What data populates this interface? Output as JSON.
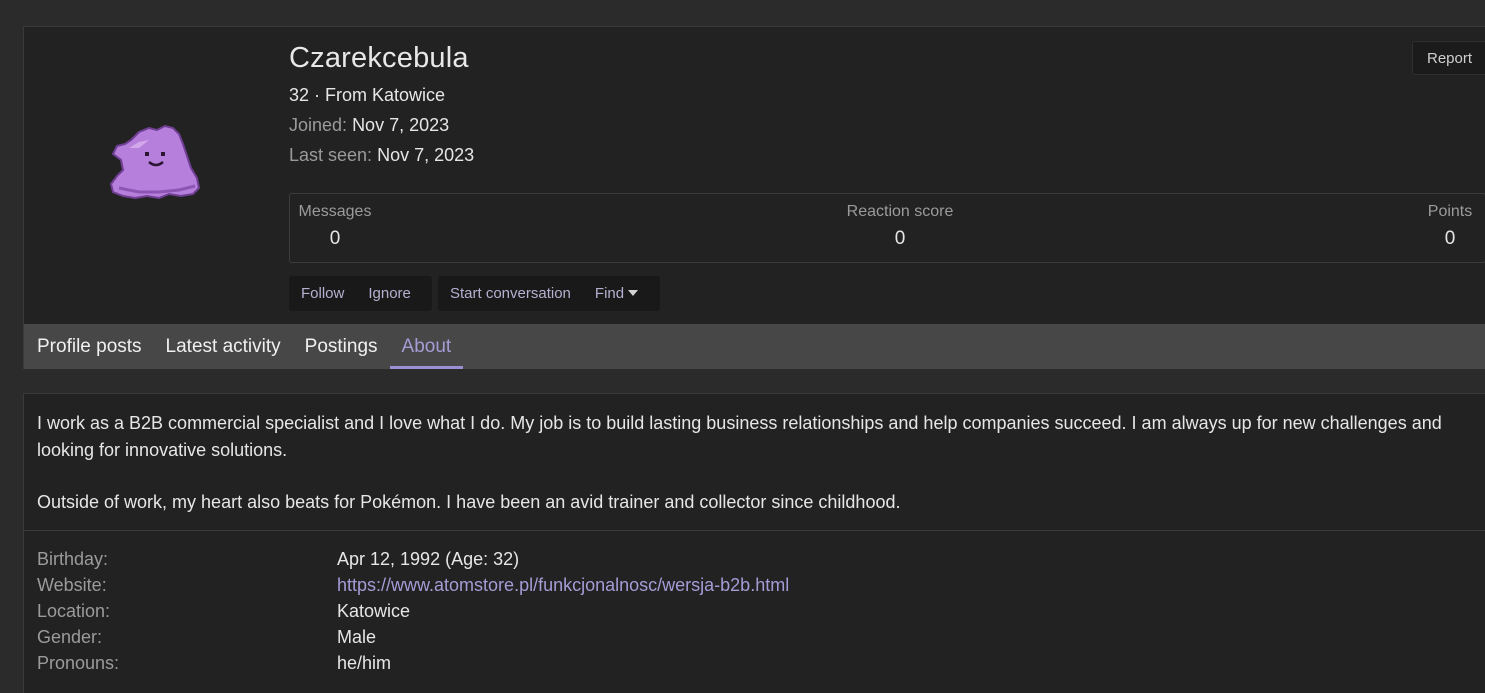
{
  "profile": {
    "username": "Czarekcebula",
    "age_location": "32 · From Katowice",
    "joined_label": "Joined:",
    "joined_value": "Nov 7, 2023",
    "last_seen_label": "Last seen:",
    "last_seen_value": "Nov 7, 2023",
    "report_label": "Report",
    "avatar_icon": "ditto-pokemon-avatar",
    "avatar_color": "#b77fdc"
  },
  "stats": {
    "messages_label": "Messages",
    "messages_value": "0",
    "reaction_label": "Reaction score",
    "reaction_value": "0",
    "points_label": "Points",
    "points_value": "0"
  },
  "actions": {
    "follow": "Follow",
    "ignore": "Ignore",
    "start_conversation": "Start conversation",
    "find": "Find"
  },
  "tabs": [
    {
      "label": "Profile posts",
      "active": false
    },
    {
      "label": "Latest activity",
      "active": false
    },
    {
      "label": "Postings",
      "active": false
    },
    {
      "label": "About",
      "active": true
    }
  ],
  "about": {
    "paragraph_1": "I work as a B2B commercial specialist and I love what I do. My job is to build lasting business relationships and help companies succeed. I am always up for new challenges and looking for innovative solutions.",
    "paragraph_2": "Outside of work, my heart also beats for Pokémon. I have been an avid trainer and collector since childhood.",
    "details": [
      {
        "label": "Birthday:",
        "value": "Apr 12, 1992 (Age: 32)"
      },
      {
        "label": "Website:",
        "value": "https://www.atomstore.pl/funkcjonalnosc/wersja-b2b.html"
      },
      {
        "label": "Location:",
        "value": "Katowice"
      },
      {
        "label": "Gender:",
        "value": "Male"
      },
      {
        "label": "Pronouns:",
        "value": "he/him"
      }
    ]
  },
  "colors": {
    "accent": "#a59cd6",
    "panel": "#222222",
    "tabs_bar": "#474747"
  }
}
